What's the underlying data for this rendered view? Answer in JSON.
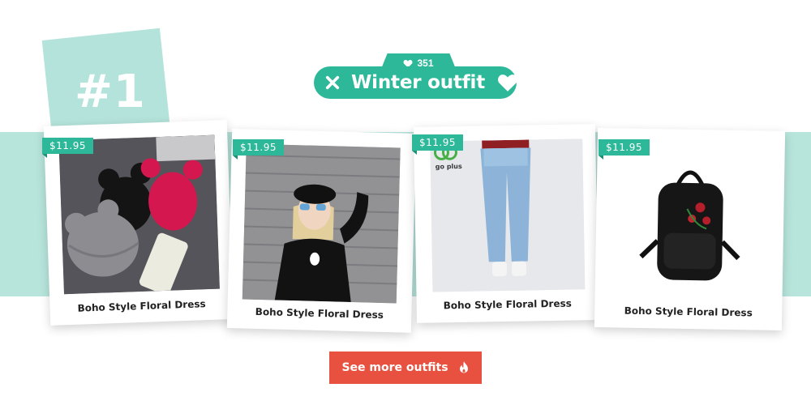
{
  "rank": {
    "label": "#1"
  },
  "outfit": {
    "likes": "351",
    "title": "Winter outfit"
  },
  "products": [
    {
      "price": "$11.95",
      "name": "Boho Style Floral Dress",
      "image": "knit-beanies-with-ears"
    },
    {
      "price": "$11.95",
      "name": "Boho Style Floral Dress",
      "image": "girl-black-sweatshirt-cap"
    },
    {
      "price": "$11.95",
      "name": "Boho Style Floral Dress",
      "image": "light-blue-mom-jeans",
      "watermark": "go plus"
    },
    {
      "price": "$11.95",
      "name": "Boho Style Floral Dress",
      "image": "black-backpack-rose-embroidery"
    }
  ],
  "cta": {
    "label": "See more outfits",
    "icon": "flame-icon"
  },
  "colors": {
    "accent": "#2eb89a",
    "band": "#b7e5dc",
    "cta": "#e8503f"
  }
}
